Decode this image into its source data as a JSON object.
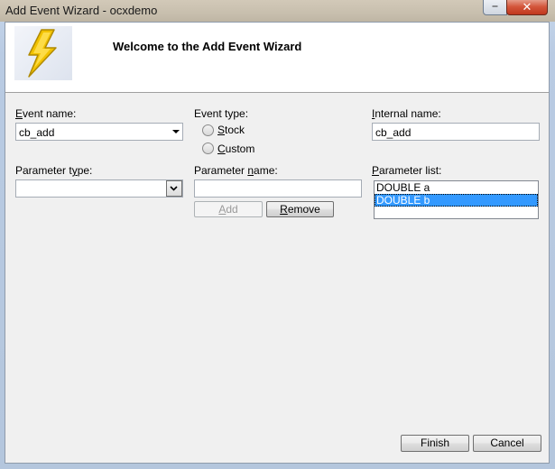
{
  "window": {
    "title": "Add Event Wizard - ocxdemo",
    "close_label": "✕",
    "min_label": "⎯"
  },
  "header": {
    "welcome": "Welcome to the Add Event Wizard",
    "logo_icon": "lightning-bolt-icon"
  },
  "form": {
    "event_name": {
      "label_u": "E",
      "label_rest": "vent name:",
      "value": "cb_add"
    },
    "event_type": {
      "label": "Event type:",
      "options": [
        {
          "u": "S",
          "rest": "tock"
        },
        {
          "u": "C",
          "rest": "ustom"
        }
      ]
    },
    "internal_name": {
      "label_u": "I",
      "label_rest": "nternal name:",
      "value": "cb_add"
    },
    "parameter_type": {
      "label_pre": "Parameter t",
      "label_u": "y",
      "label_rest": "pe:",
      "value": ""
    },
    "parameter_name": {
      "label_pre": "Parameter ",
      "label_u": "n",
      "label_rest": "ame:",
      "value": ""
    },
    "parameter_list": {
      "label_pre": "",
      "label_u": "P",
      "label_rest": "arameter list:",
      "items": [
        "DOUBLE a",
        "DOUBLE b"
      ],
      "selected_index": 1
    },
    "add_button": {
      "u": "A",
      "rest": "dd"
    },
    "remove_button": {
      "u": "R",
      "rest": "emove"
    }
  },
  "footer": {
    "finish": "Finish",
    "cancel": "Cancel"
  },
  "colors": {
    "selection": "#3399ff",
    "bolt": "#f2c200"
  }
}
